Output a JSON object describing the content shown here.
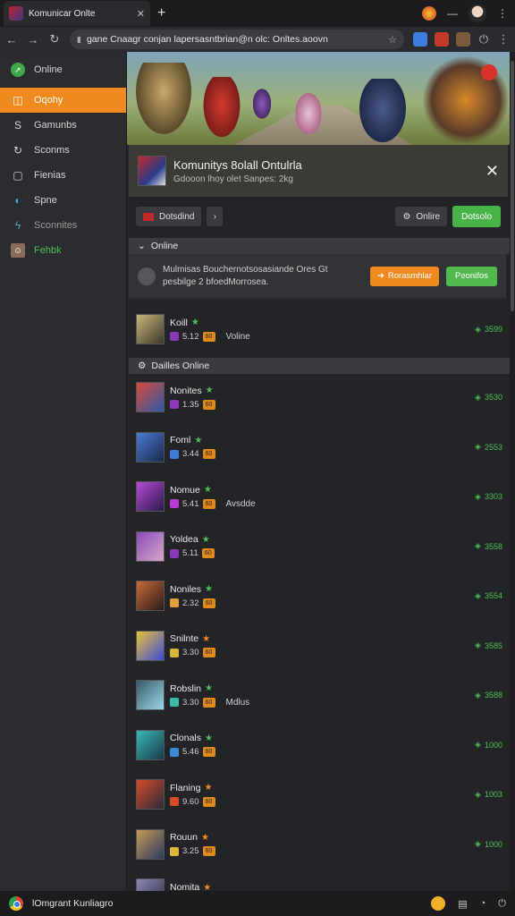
{
  "browser": {
    "tab_title": "Komunicar Onlte",
    "tab_close": "✕",
    "new_tab": "+",
    "url": "gane Cnaagr  conjan lapersasntbrian@n olc: Onltes.aoovn"
  },
  "sidebar": {
    "items": [
      {
        "label": "Online",
        "icon": "➚"
      },
      {
        "label": "Oqohy",
        "icon": "◫"
      },
      {
        "label": "Gamunbs",
        "icon": "S"
      },
      {
        "label": "Sconms",
        "icon": "↻"
      },
      {
        "label": "Fienias",
        "icon": "▢"
      },
      {
        "label": "Spne",
        "icon": "◐"
      },
      {
        "label": "Sconnites",
        "icon": "ϟ"
      },
      {
        "label": "Fehbk",
        "icon": "☺"
      }
    ]
  },
  "card": {
    "title": "Komunitys 8olall Ontulrla",
    "subtitle": "Gdooon lhoy olet Sanpes: 2kg",
    "close": "✕"
  },
  "actions": {
    "left_label": "Dotsdind",
    "chevron": "›",
    "online_label": "Onlire",
    "green_label": "Dotsolo"
  },
  "section_online": {
    "label": "Online",
    "chevron": "⌄"
  },
  "notice": {
    "line1": "Mulmisas  Bouchernotsosasiande Ores Gt",
    "line2": "pesbilge 2 bfoedMorrosea.",
    "btn_orange": "Rorasmhlar",
    "btn_green": "Peonifos"
  },
  "featured": {
    "name": "Koill",
    "level": "5.12",
    "tag": "60",
    "extra": "Voline",
    "pts": "3599",
    "star": "★",
    "star_color": "#4fbf55"
  },
  "section_daily": {
    "label": "Dailles Online"
  },
  "players": [
    {
      "name": "Nonites",
      "level": "1.35",
      "tag": "60",
      "extra": "",
      "pts": "3530",
      "star_color": "#4fbf55"
    },
    {
      "name": "Foml",
      "level": "3.44",
      "tag": "60",
      "extra": "",
      "pts": "2553",
      "star_color": "#4fbf55"
    },
    {
      "name": "Nomue",
      "level": "5.41",
      "tag": "60",
      "extra": "Avsdde",
      "pts": "3303",
      "star_color": "#4fbf55"
    },
    {
      "name": "Yoldea",
      "level": "5.11",
      "tag": "60",
      "extra": "",
      "pts": "3558",
      "star_color": "#4fbf55"
    },
    {
      "name": "Noniles",
      "level": "2.32",
      "tag": "60",
      "extra": "",
      "pts": "3554",
      "star_color": "#4fbf55"
    },
    {
      "name": "Snilnte",
      "level": "3.30",
      "tag": "60",
      "extra": "",
      "pts": "3585",
      "star_color": "#ef8a1e"
    },
    {
      "name": "Robslin",
      "level": "3.30",
      "tag": "60",
      "extra": "Mdlus",
      "pts": "3588",
      "star_color": "#4fbf55"
    },
    {
      "name": "Clonals",
      "level": "5.46",
      "tag": "60",
      "extra": "",
      "pts": "1000",
      "star_color": "#4fbf55"
    },
    {
      "name": "Flaning",
      "level": "9.60",
      "tag": "60",
      "extra": "",
      "pts": "1003",
      "star_color": "#ef8a1e"
    },
    {
      "name": "Rouun",
      "level": "3.25",
      "tag": "60",
      "extra": "",
      "pts": "1000",
      "star_color": "#ef8a1e"
    },
    {
      "name": "Nomita",
      "level": "",
      "tag": "",
      "extra": "",
      "pts": "",
      "star_color": "#ef8a1e"
    }
  ],
  "taskbar": {
    "label": "lOmgrant Kunliagro"
  }
}
